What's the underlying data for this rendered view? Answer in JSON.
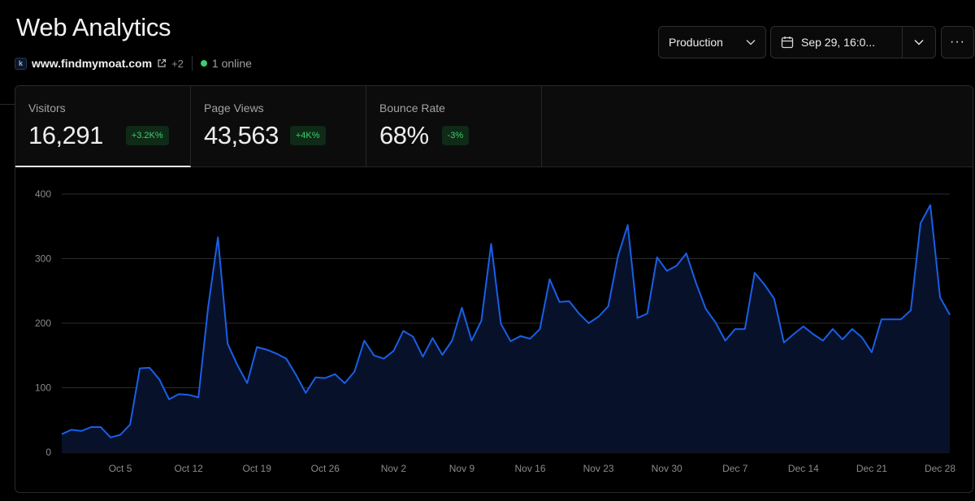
{
  "header": {
    "title": "Web Analytics",
    "favicon_glyph": "k",
    "domain": "www.findmymoat.com",
    "extra_domains": "+2",
    "online": "1 online"
  },
  "controls": {
    "environment": "Production",
    "date_range": "Sep 29, 16:0...",
    "more_label": "···"
  },
  "tabs": [
    {
      "label": "Visitors",
      "value": "16,291",
      "delta": "+3.2K%",
      "active": true
    },
    {
      "label": "Page Views",
      "value": "43,563",
      "delta": "+4K%",
      "active": false
    },
    {
      "label": "Bounce Rate",
      "value": "68%",
      "delta": "-3%",
      "active": false
    }
  ],
  "colors": {
    "line": "#1a5fe6",
    "area": "#07112a",
    "grid": "#2c2c2c",
    "positive": "#3ccf6e"
  },
  "chart_data": {
    "type": "area",
    "start_date": "2024-09-29",
    "y_ticks": [
      0,
      100,
      200,
      300,
      400
    ],
    "ylim": [
      0,
      400
    ],
    "x_tick_labels": [
      {
        "day_index": 6,
        "label": "Oct 5"
      },
      {
        "day_index": 13,
        "label": "Oct 12"
      },
      {
        "day_index": 20,
        "label": "Oct 19"
      },
      {
        "day_index": 27,
        "label": "Oct 26"
      },
      {
        "day_index": 34,
        "label": "Nov 2"
      },
      {
        "day_index": 41,
        "label": "Nov 9"
      },
      {
        "day_index": 48,
        "label": "Nov 16"
      },
      {
        "day_index": 55,
        "label": "Nov 23"
      },
      {
        "day_index": 62,
        "label": "Nov 30"
      },
      {
        "day_index": 69,
        "label": "Dec 7"
      },
      {
        "day_index": 76,
        "label": "Dec 14"
      },
      {
        "day_index": 83,
        "label": "Dec 21"
      },
      {
        "day_index": 90,
        "label": "Dec 28"
      }
    ],
    "series": [
      {
        "name": "Visitors",
        "values": [
          28,
          35,
          33,
          39,
          39,
          23,
          27,
          43,
          130,
          131,
          113,
          82,
          90,
          89,
          85,
          225,
          333,
          168,
          135,
          107,
          163,
          159,
          153,
          145,
          120,
          92,
          116,
          115,
          121,
          107,
          125,
          173,
          150,
          145,
          157,
          188,
          179,
          148,
          177,
          151,
          173,
          224,
          173,
          204,
          323,
          199,
          172,
          180,
          176,
          191,
          268,
          233,
          234,
          215,
          200,
          210,
          226,
          304,
          352,
          208,
          215,
          302,
          281,
          289,
          308,
          262,
          222,
          201,
          173,
          191,
          191,
          278,
          260,
          238,
          170,
          183,
          195,
          183,
          173,
          191,
          175,
          191,
          178,
          155,
          206,
          206,
          206,
          220,
          355,
          383,
          240,
          213
        ]
      }
    ]
  }
}
